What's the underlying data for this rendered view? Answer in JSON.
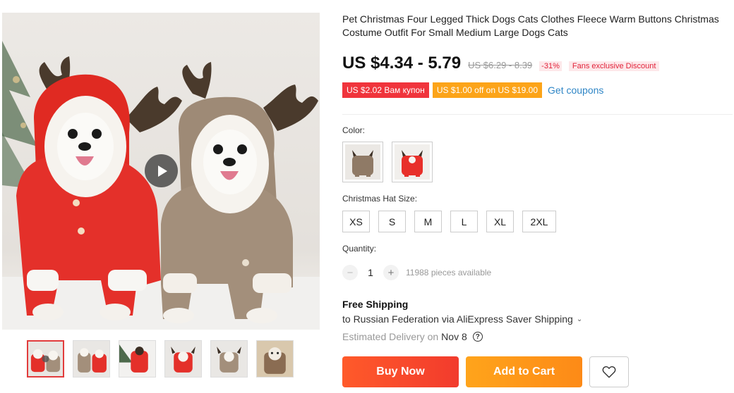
{
  "product": {
    "title": "Pet Christmas Four Legged Thick Dogs Cats Clothes Fleece Warm Buttons Christmas Costume Outfit For Small Medium Large Dogs Cats"
  },
  "price": {
    "current": "US $4.34 - 5.79",
    "original": "US $6.29 - 8.39",
    "discount": "-31%",
    "fans_badge": "Fans exclusive Discount"
  },
  "coupons": {
    "store_coupon": "US $2.02 Вам купон",
    "select_coupon": "US $1.00 off on US $19.00",
    "get_coupons": "Get coupons"
  },
  "color": {
    "label": "Color:",
    "options": [
      {
        "name": "brown reindeer",
        "color": "#8f7a66"
      },
      {
        "name": "red reindeer",
        "color": "#e8302a"
      }
    ]
  },
  "size": {
    "label": "Christmas Hat Size:",
    "options": [
      "XS",
      "S",
      "M",
      "L",
      "XL",
      "2XL"
    ]
  },
  "quantity": {
    "label": "Quantity:",
    "minus": "−",
    "value": "1",
    "plus": "+",
    "available": "11988 pieces available"
  },
  "shipping": {
    "title": "Free Shipping",
    "route": "to Russian Federation via AliExpress Saver Shipping",
    "chevron": "⌄",
    "estimate_label": "Estimated Delivery on",
    "estimate_date": "Nov 8",
    "help_icon": "?"
  },
  "actions": {
    "buy_now": "Buy Now",
    "add_to_cart": "Add to Cart",
    "wishlist_icon": "heart-icon"
  },
  "gallery": {
    "thumbnail_count": 6,
    "active_thumbnail": 0
  },
  "colors": {
    "red_costume": "#e8302a",
    "brown_costume": "#8f7a66",
    "buy_now": "#f23b2d",
    "add_to_cart": "#fd8a17",
    "price_red": "#e2233a",
    "link_blue": "#2f86c6"
  }
}
